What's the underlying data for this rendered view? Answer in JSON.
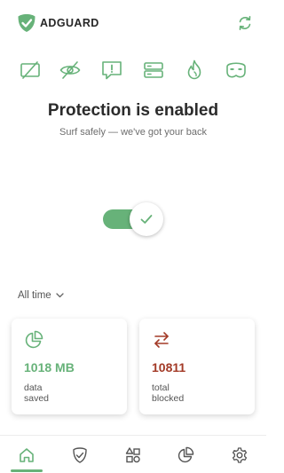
{
  "app": {
    "brand": "ADGUARD"
  },
  "header": {
    "logo_icon": "adguard-shield-icon",
    "refresh_icon": "refresh-icon"
  },
  "features": [
    {
      "name": "ad-blocking",
      "icon": "crossed-screen-icon"
    },
    {
      "name": "tracking-protection",
      "icon": "crossed-eye-icon"
    },
    {
      "name": "annoyances",
      "icon": "exclamation-bubble-icon"
    },
    {
      "name": "dns-protection",
      "icon": "server-icon"
    },
    {
      "name": "firewall",
      "icon": "flame-icon"
    },
    {
      "name": "stealth-mode",
      "icon": "mask-icon"
    }
  ],
  "status": {
    "title": "Protection is enabled",
    "subtitle": "Surf safely — we've got your back",
    "enabled": true
  },
  "stats": {
    "period": "All time",
    "cards": [
      {
        "value": "1018 MB",
        "label_line1": "data",
        "label_line2": "saved",
        "icon": "pie-chart-icon"
      },
      {
        "value": "10811",
        "label_line1": "total",
        "label_line2": "blocked",
        "icon": "swap-arrows-icon"
      }
    ]
  },
  "nav": {
    "active": "home",
    "items": [
      "home-icon",
      "shield-check-icon",
      "apps-icon",
      "statistics-icon",
      "settings-icon"
    ]
  },
  "colors": {
    "accent": "#67b279",
    "blocked": "#a33a27",
    "icon_green": "#67b279"
  }
}
